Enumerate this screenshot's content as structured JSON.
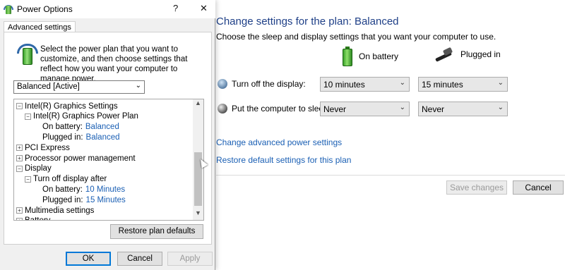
{
  "background": {
    "title": "Change settings for the plan: Balanced",
    "subtitle": "Choose the sleep and display settings that you want your computer to use.",
    "col_battery": "On battery",
    "col_plugged": "Plugged in",
    "rows": [
      {
        "label": "Turn off the display:",
        "battery": "10 minutes",
        "plugged": "15 minutes"
      },
      {
        "label": "Put the computer to sleep:",
        "battery": "Never",
        "plugged": "Never"
      }
    ],
    "link_advanced": "Change advanced power settings",
    "link_restore": "Restore default settings for this plan",
    "save_label": "Save changes",
    "cancel_label": "Cancel"
  },
  "dialog": {
    "title": "Power Options",
    "help": "?",
    "close": "✕",
    "tab": "Advanced settings",
    "intro": "Select the power plan that you want to customize, and then choose settings that reflect how you want your computer to manage power.",
    "plan": "Balanced [Active]",
    "tree": [
      {
        "indent": 0,
        "exp": "−",
        "label": "Intel(R) Graphics Settings",
        "value": ""
      },
      {
        "indent": 1,
        "exp": "−",
        "label": "Intel(R) Graphics Power Plan",
        "value": ""
      },
      {
        "indent": 2,
        "exp": "",
        "label": "On battery:",
        "value": "Balanced"
      },
      {
        "indent": 2,
        "exp": "",
        "label": "Plugged in:",
        "value": "Balanced"
      },
      {
        "indent": 0,
        "exp": "+",
        "label": "PCI Express",
        "value": ""
      },
      {
        "indent": 0,
        "exp": "+",
        "label": "Processor power management",
        "value": ""
      },
      {
        "indent": 0,
        "exp": "−",
        "label": "Display",
        "value": ""
      },
      {
        "indent": 1,
        "exp": "−",
        "label": "Turn off display after",
        "value": ""
      },
      {
        "indent": 2,
        "exp": "",
        "label": "On battery:",
        "value": "10 Minutes"
      },
      {
        "indent": 2,
        "exp": "",
        "label": "Plugged in:",
        "value": "15 Minutes"
      },
      {
        "indent": 0,
        "exp": "+",
        "label": "Multimedia settings",
        "value": ""
      },
      {
        "indent": 0,
        "exp": "+",
        "label": "Battery",
        "value": ""
      }
    ],
    "restore_label": "Restore plan defaults",
    "ok_label": "OK",
    "cancel_label": "Cancel",
    "apply_label": "Apply"
  }
}
